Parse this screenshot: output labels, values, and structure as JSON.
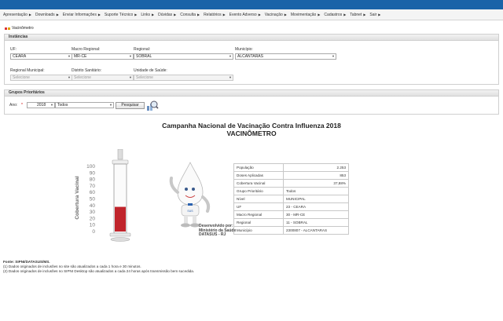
{
  "menu": [
    "Apresentação",
    "Downloads",
    "Enviar Informações",
    "Suporte Técnico",
    "Links",
    "Dúvidas",
    "Consulta",
    "Relatórios",
    "Evento Adverso",
    "Vacinação",
    "Movimentação",
    "Cadastros",
    "Tabnet",
    "Sair"
  ],
  "breadcrumb": "Vacinômetro",
  "instancias": {
    "title": "Instâncias",
    "uf_label": "UF:",
    "uf_value": "CEARA",
    "macro_label": "Macro Regional:",
    "macro_value": "MR-CE",
    "regional_label": "Regional:",
    "regional_value": "SOBRAL",
    "municipio_label": "Município:",
    "municipio_value": "ALCANTARAS",
    "regional_municipal_label": "Regional Municipal:",
    "regional_municipal_value": "Selecione",
    "distrito_label": "Distrito Sanitário:",
    "distrito_value": "Selecione",
    "unidade_label": "Unidade de Saúde:",
    "unidade_value": "Selecione"
  },
  "grupos": {
    "title": "Grupos Prioritários",
    "ano_label": "Ano:",
    "ano_required": "*",
    "ano_value": "2018",
    "grupo_value": "Todos",
    "pesquisar_label": "Pesquisar"
  },
  "campaign_title": "Campanha Nacional de Vacinação Contra Influenza 2018",
  "campaign_subtitle": "VACINÔMETRO",
  "gauge": {
    "axis_label": "Cobertura Vacinal",
    "ticks": [
      "100",
      "90",
      "80",
      "70",
      "60",
      "50",
      "40",
      "30",
      "20",
      "10",
      "0"
    ],
    "coverage_percent": 37.88,
    "fill_color": "#c0242b"
  },
  "mascot": {
    "badge": "SUS",
    "credit_line1": "Desenvolvido por:",
    "credit_line2": "Ministério da Saúde",
    "credit_line3": "DATASUS - RJ"
  },
  "stats": [
    {
      "label": "População",
      "value": "2.253"
    },
    {
      "label": "Doses Aplicadas",
      "value": "853"
    },
    {
      "label": "Cobertura Vacinal",
      "value": "37,88%"
    },
    {
      "label": "Grupo Prioritário",
      "value": "Todos"
    },
    {
      "label": "Nível",
      "value": "MUNICIPAL"
    },
    {
      "label": "UF",
      "value": "23 - CEARA"
    },
    {
      "label": "Macro Regional",
      "value": "30 - MR-CE"
    },
    {
      "label": "Regional",
      "value": "11 - SOBRAL"
    },
    {
      "label": "Município",
      "value": "2300807 - ALCANTARAS"
    }
  ],
  "footer": {
    "source": "Fonte: SIPNI/DATASUS/MS.",
    "note1": "(1) Dados originados de inclusões no site são atualizados a cada 1 hora e 30 minutos.",
    "note2": "(2) Dados originados de inclusões no SIPNI Desktop são atualizados a cada 24 horas após transmissão bem sucedida."
  }
}
